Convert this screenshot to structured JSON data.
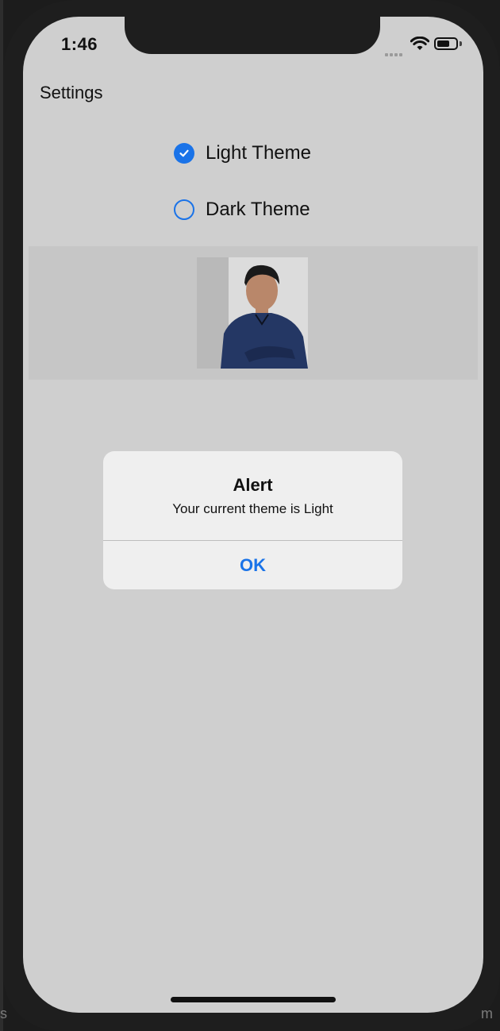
{
  "status_bar": {
    "time": "1:46"
  },
  "header": {
    "title": "Settings"
  },
  "theme_options": [
    {
      "label": "Light Theme",
      "selected": true
    },
    {
      "label": "Dark Theme",
      "selected": false
    }
  ],
  "alert": {
    "title": "Alert",
    "message": "Your current theme is Light",
    "button_label": "OK"
  },
  "colors": {
    "accent": "#1a73e8",
    "screen_background": "#cfcfcf",
    "dialog_background": "#efefef"
  },
  "edge_fragments": {
    "left": "s",
    "right": "m"
  }
}
